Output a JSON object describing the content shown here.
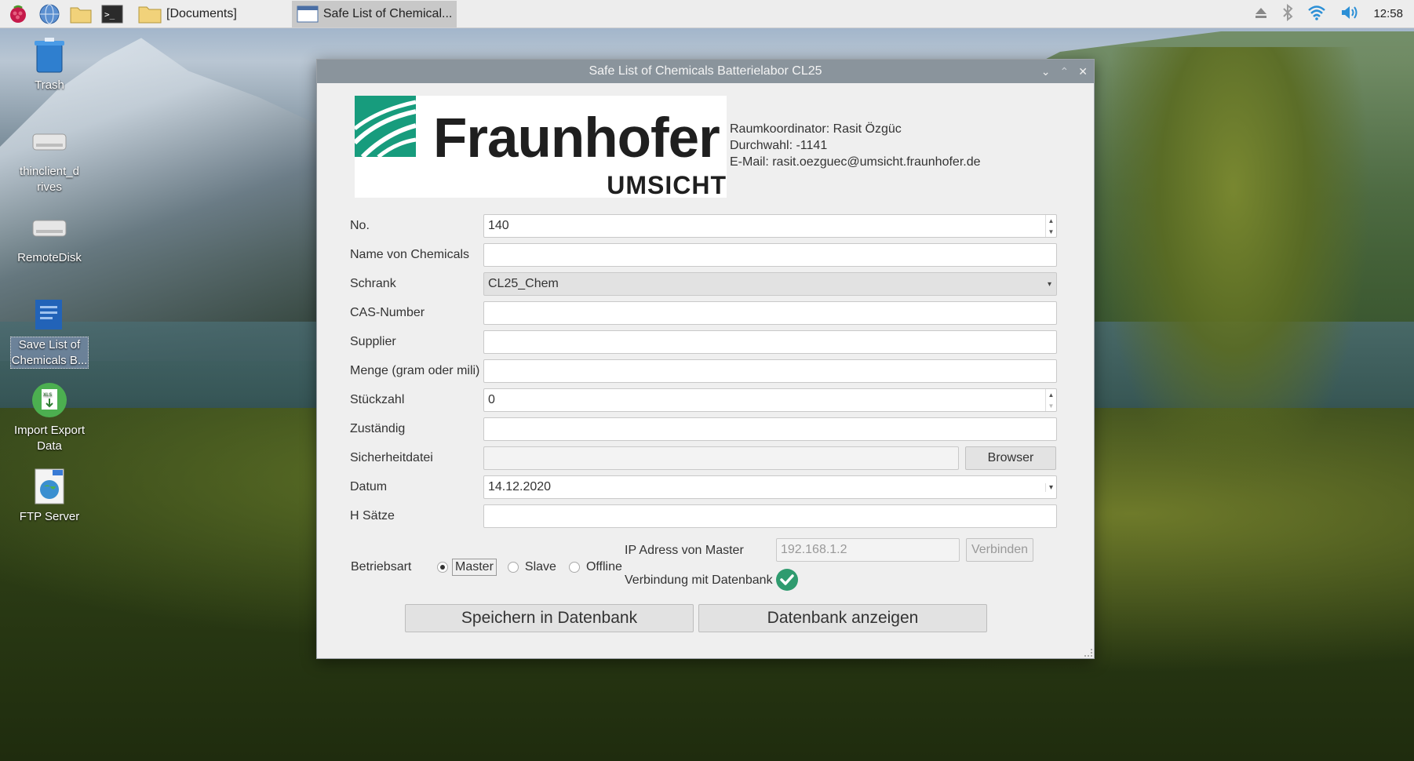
{
  "taskbar": {
    "tasks": [
      {
        "label": "[Documents]"
      },
      {
        "label": "Safe List of Chemical..."
      }
    ],
    "clock": "12:58"
  },
  "desktop": {
    "icons": [
      {
        "label": "Trash"
      },
      {
        "label": "thinclient_drives"
      },
      {
        "label": "RemoteDisk"
      },
      {
        "label": "Save List of Chemicals B..."
      },
      {
        "label": "Import Export Data"
      },
      {
        "label": "FTP Server"
      }
    ]
  },
  "dialog": {
    "title": "Safe List of Chemicals Batterielabor CL25",
    "logo": {
      "brand": "Fraunhofer",
      "institute": "UMSICHT"
    },
    "contact": {
      "coordinator": "Raumkoordinator: Rasit Özgüc",
      "phone": "Durchwahl: -1141",
      "email": "E-Mail: rasit.oezguec@umsicht.fraunhofer.de"
    },
    "form": {
      "no": {
        "label": "No.",
        "value": "140"
      },
      "name": {
        "label": "Name von Chemicals",
        "value": ""
      },
      "schrank": {
        "label": "Schrank",
        "value": "CL25_Chem"
      },
      "cas": {
        "label": "CAS-Number",
        "value": ""
      },
      "supplier": {
        "label": "Supplier",
        "value": ""
      },
      "menge": {
        "label": "Menge (gram oder mili)",
        "value": ""
      },
      "stueckzahl": {
        "label": "Stückzahl",
        "value": "0"
      },
      "zustaendig": {
        "label": "Zuständig",
        "value": ""
      },
      "sicherheitdatei": {
        "label": "Sicherheitdatei",
        "value": "",
        "button": "Browser"
      },
      "datum": {
        "label": "Datum",
        "value": "14.12.2020"
      },
      "hsaetze": {
        "label": "H Sätze",
        "value": ""
      }
    },
    "betriebsart": {
      "label": "Betriebsart",
      "options": [
        "Master",
        "Slave",
        "Offline"
      ],
      "selected": "Master"
    },
    "ip": {
      "label": "IP Adress von Master",
      "placeholder": "192.168.1.2",
      "connect_button": "Verbinden"
    },
    "db_status": {
      "label": "Verbindung mit Datenbank",
      "connected": true
    },
    "buttons": {
      "save": "Speichern in Datenbank",
      "show": "Datenbank anzeigen"
    }
  }
}
